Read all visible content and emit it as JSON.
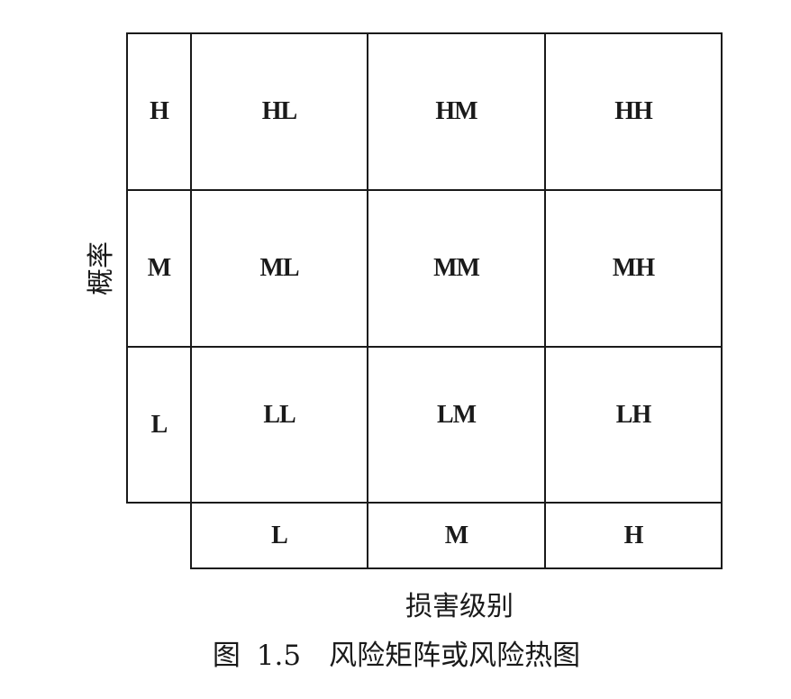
{
  "axes": {
    "probability_label": "概率",
    "severity_label": "损害级别"
  },
  "caption": "图 1.5　风险矩阵或风险热图",
  "row_headers": [
    "H",
    "M",
    "L"
  ],
  "column_headers": [
    "L",
    "M",
    "H"
  ],
  "cells": [
    [
      "HL",
      "HM",
      "HH"
    ],
    [
      "ML",
      "MM",
      "MH"
    ],
    [
      "LL",
      "LM",
      "LH"
    ]
  ]
}
